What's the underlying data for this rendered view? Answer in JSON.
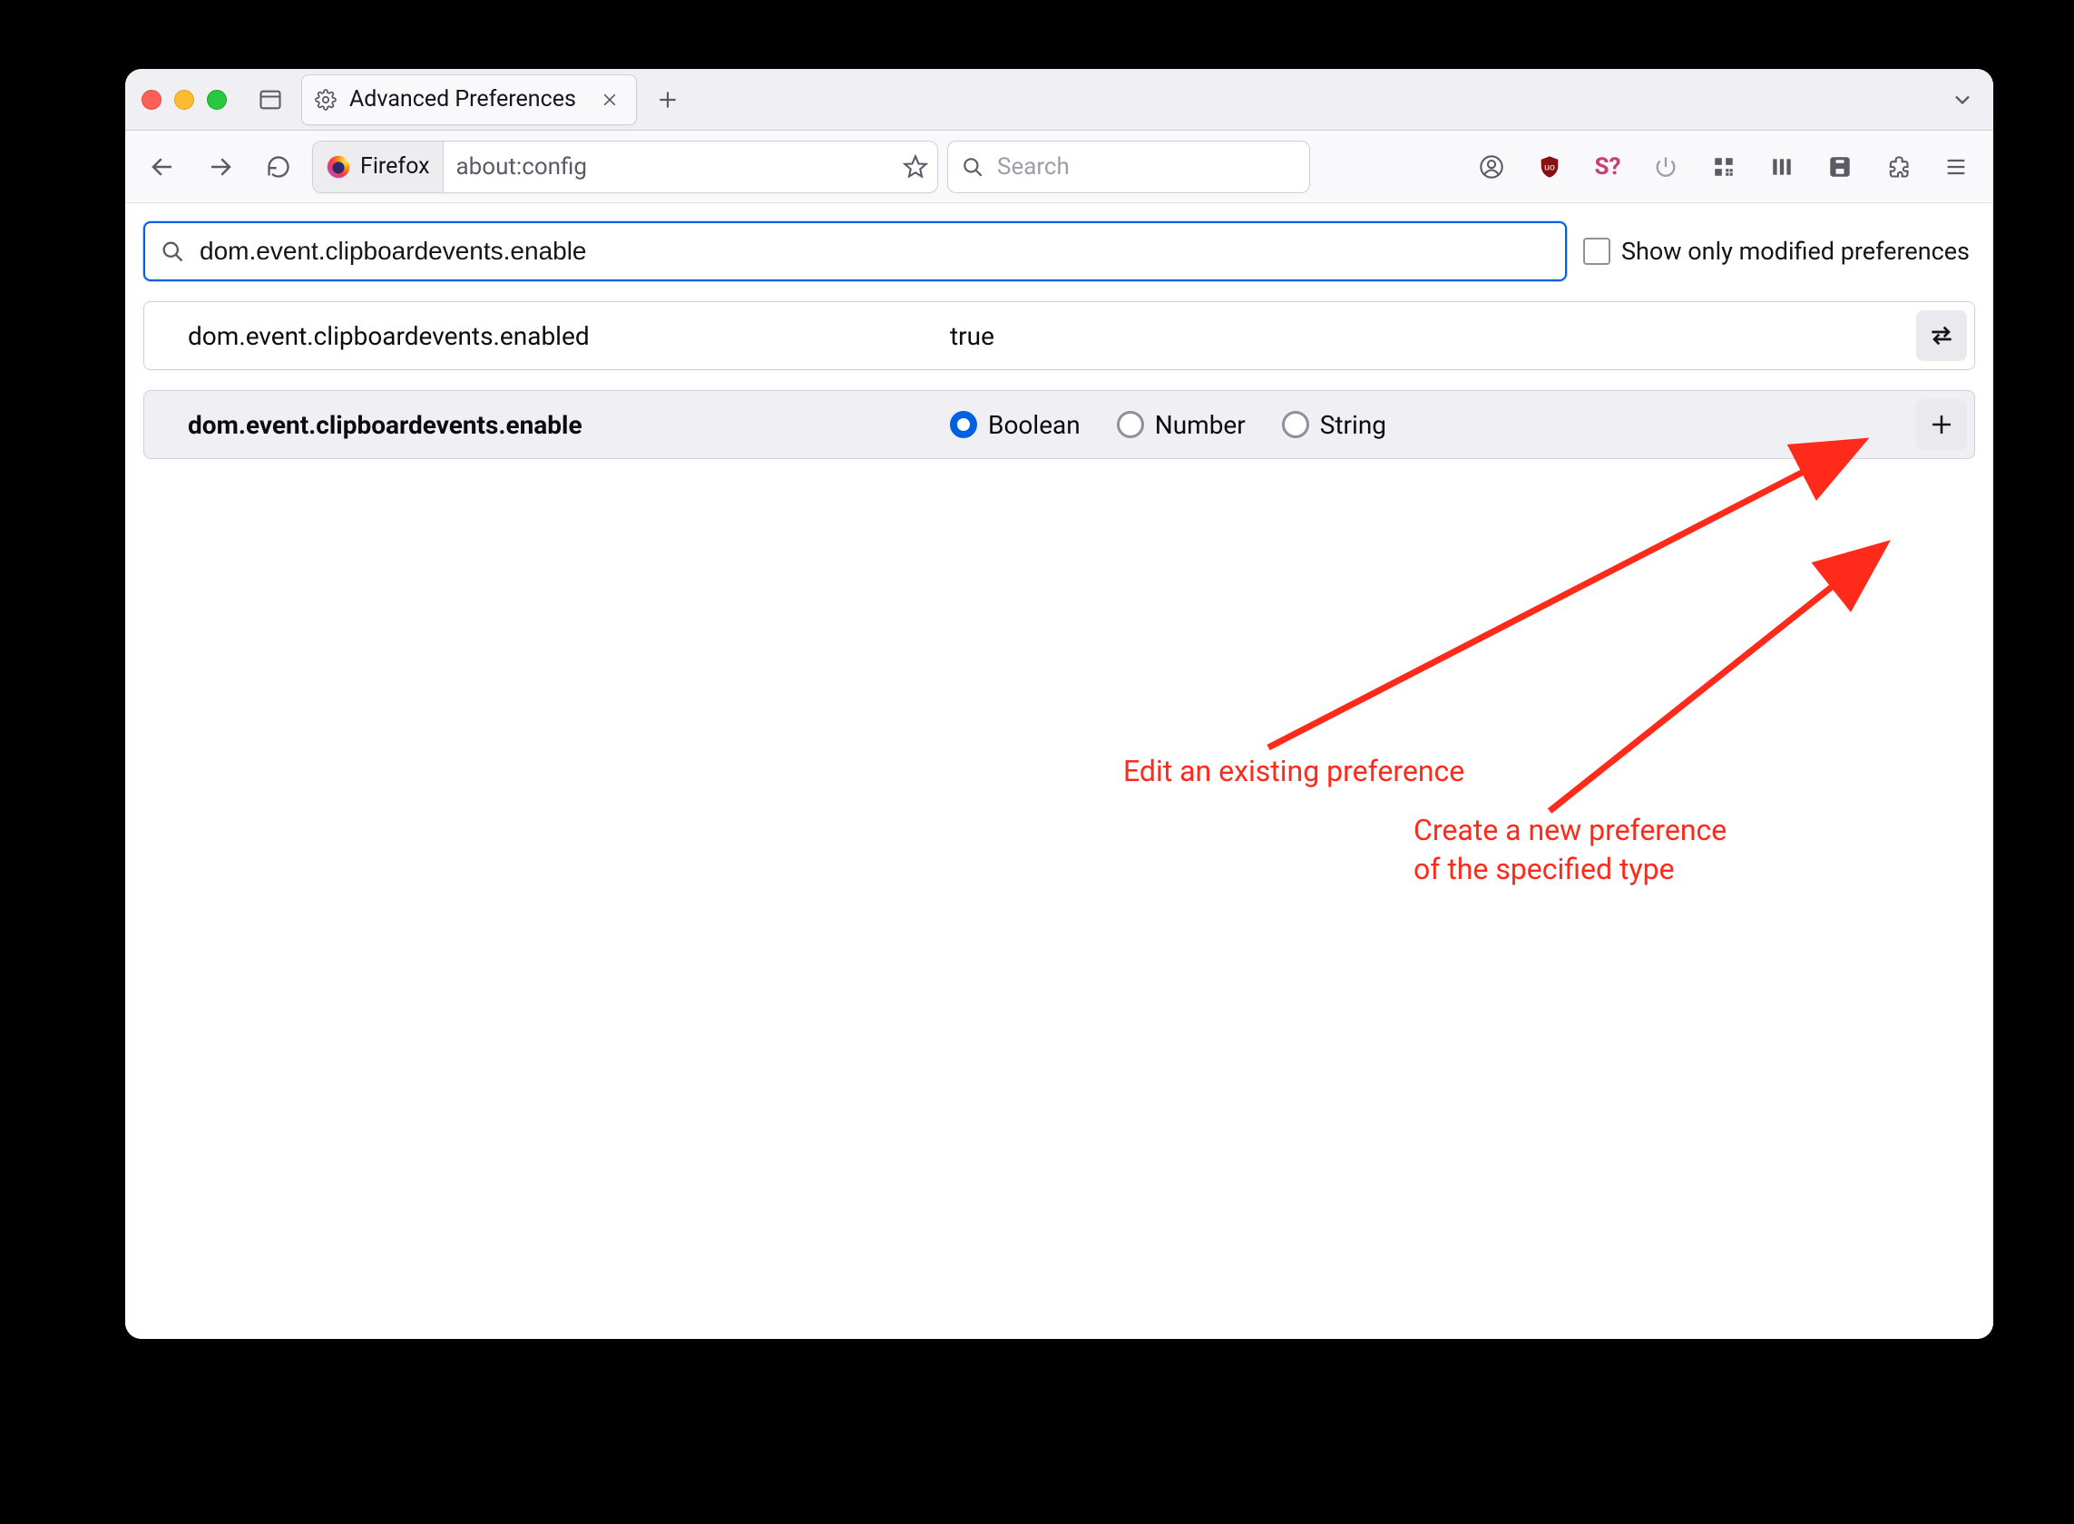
{
  "tab": {
    "title": "Advanced Preferences"
  },
  "address": {
    "chip": "Firefox",
    "url": "about:config"
  },
  "search": {
    "placeholder": "Search"
  },
  "filter": {
    "value": "dom.event.clipboardevents.enable"
  },
  "show_modified": {
    "label": "Show only modified preferences"
  },
  "rows": {
    "existing": {
      "name": "dom.event.clipboardevents.enabled",
      "value": "true"
    },
    "new": {
      "name": "dom.event.clipboardevents.enable",
      "types": {
        "boolean": "Boolean",
        "number": "Number",
        "string": "String"
      }
    }
  },
  "annotations": {
    "edit": "Edit an existing preference",
    "create_l1": "Create a new preference",
    "create_l2": "of the specified type"
  }
}
